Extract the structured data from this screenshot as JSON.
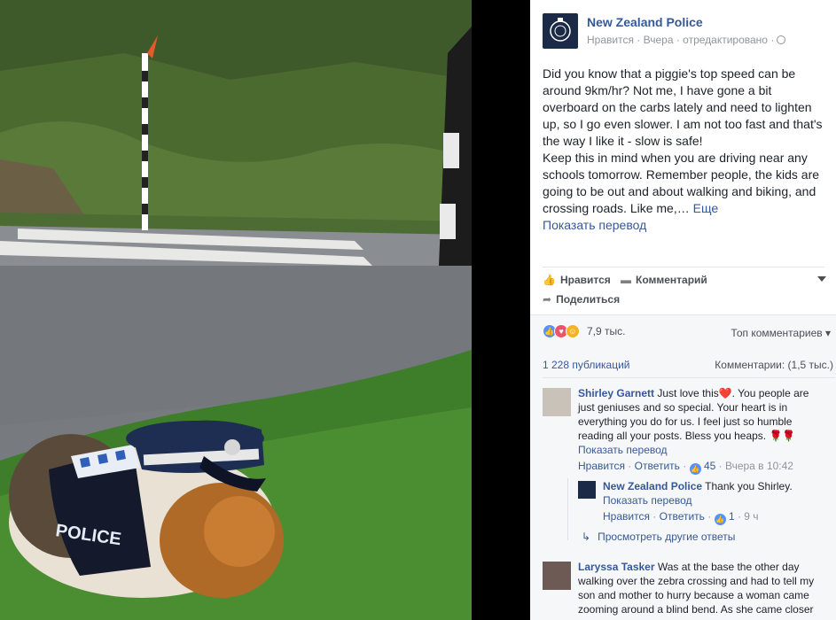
{
  "post": {
    "page_name": "New Zealand Police",
    "like_link": "Нравится",
    "meta_rest": "· Вчера · отредактировано ·",
    "paragraph1": "Did you know that a piggie's top speed can be around 9km/hr? Not me, I have gone a bit overboard on the carbs lately and need to lighten up, so I go even slower. I am not too fast and that's the way I like it - slow is safe!",
    "paragraph2": "Keep this in mind when you are driving near any schools tomorrow. Remember people, the kids are going to be out and about walking and biking, and crossing roads. Like me,…",
    "more_label": "Еще",
    "translate_label": "Показать перевод"
  },
  "photo": {
    "vest_text": "POLICE"
  },
  "actions": {
    "like": "Нравится",
    "comment": "Комментарий",
    "share": "Поделиться"
  },
  "reactions": {
    "count": "7,9 тыс.",
    "sort_label": "Топ комментариев"
  },
  "stats": {
    "shares": "1 228 публикаций",
    "comments": "Комментарии: (1,5 тыс.)"
  },
  "comments": [
    {
      "author": "Shirley Garnett",
      "text": "Just love this❤️. You people are just geniuses and so special. Your heart is in everything you do for us. I feel just so humble reading all your posts. Bless you heaps. 🌹🌹",
      "translate": "Показать перевод",
      "like": "Нравится",
      "reply": "Ответить",
      "likes": "45",
      "time": "Вчера в 10:42"
    },
    {
      "author": "Laryssa Tasker",
      "text": "Was at the base the other day walking over the zebra crossing and had to tell my son and mother to hurry because a woman came zooming around a blind bend. As she came closer"
    }
  ],
  "reply": {
    "author": "New Zealand Police",
    "text": "Thank you Shirley.",
    "translate": "Показать перевод",
    "like": "Нравится",
    "reply": "Ответить",
    "likes": "1",
    "time": "9 ч",
    "more_replies": "Просмотреть другие ответы"
  }
}
